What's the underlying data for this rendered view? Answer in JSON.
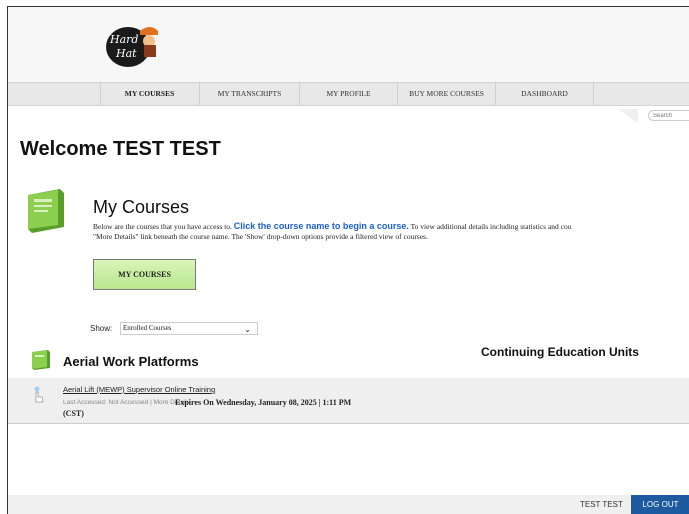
{
  "logo_text": "Hard Hat",
  "nav": {
    "items": [
      {
        "label": "MY COURSES",
        "active": true
      },
      {
        "label": "MY TRANSCRIPTS"
      },
      {
        "label": "MY PROFILE"
      },
      {
        "label": "BUY MORE COURSES"
      },
      {
        "label": "DASHBOARD"
      }
    ]
  },
  "search": {
    "placeholder": "Search"
  },
  "welcome": "Welcome TEST TEST",
  "my_courses": {
    "title": "My Courses",
    "desc_part1": "Below are the courses that you have access to. ",
    "desc_highlight": "Click the course name to begin a course.",
    "desc_part2": " To view additional details including statistics and cou",
    "desc_line2": "\"More Details\" link beneath the course name. The 'Show' drop-down options provide a filtered view of courses.",
    "button_label": "MY COURSES"
  },
  "show": {
    "label": "Show:",
    "selected": "Enrolled Courses"
  },
  "section": {
    "title": "Aerial Work Platforms",
    "ceu_label": "Continuing Education Units"
  },
  "course": {
    "name": "Aerial Lift (MEWP) Supervisor Online Training",
    "last_accessed": "Last Accessed: Not Accessed",
    "separator": " | ",
    "more_details": "More Details",
    "expires": "Expires On Wednesday, January 08, 2025 | 1:11 PM",
    "timezone": "(CST)"
  },
  "footer": {
    "user": "TEST TEST",
    "logout": "LOG OUT"
  },
  "colors": {
    "accent_blue": "#1e5aa0",
    "link_blue": "#1a5fd1",
    "button_green": "#c6ee9f",
    "book_green": "#7cc242"
  }
}
